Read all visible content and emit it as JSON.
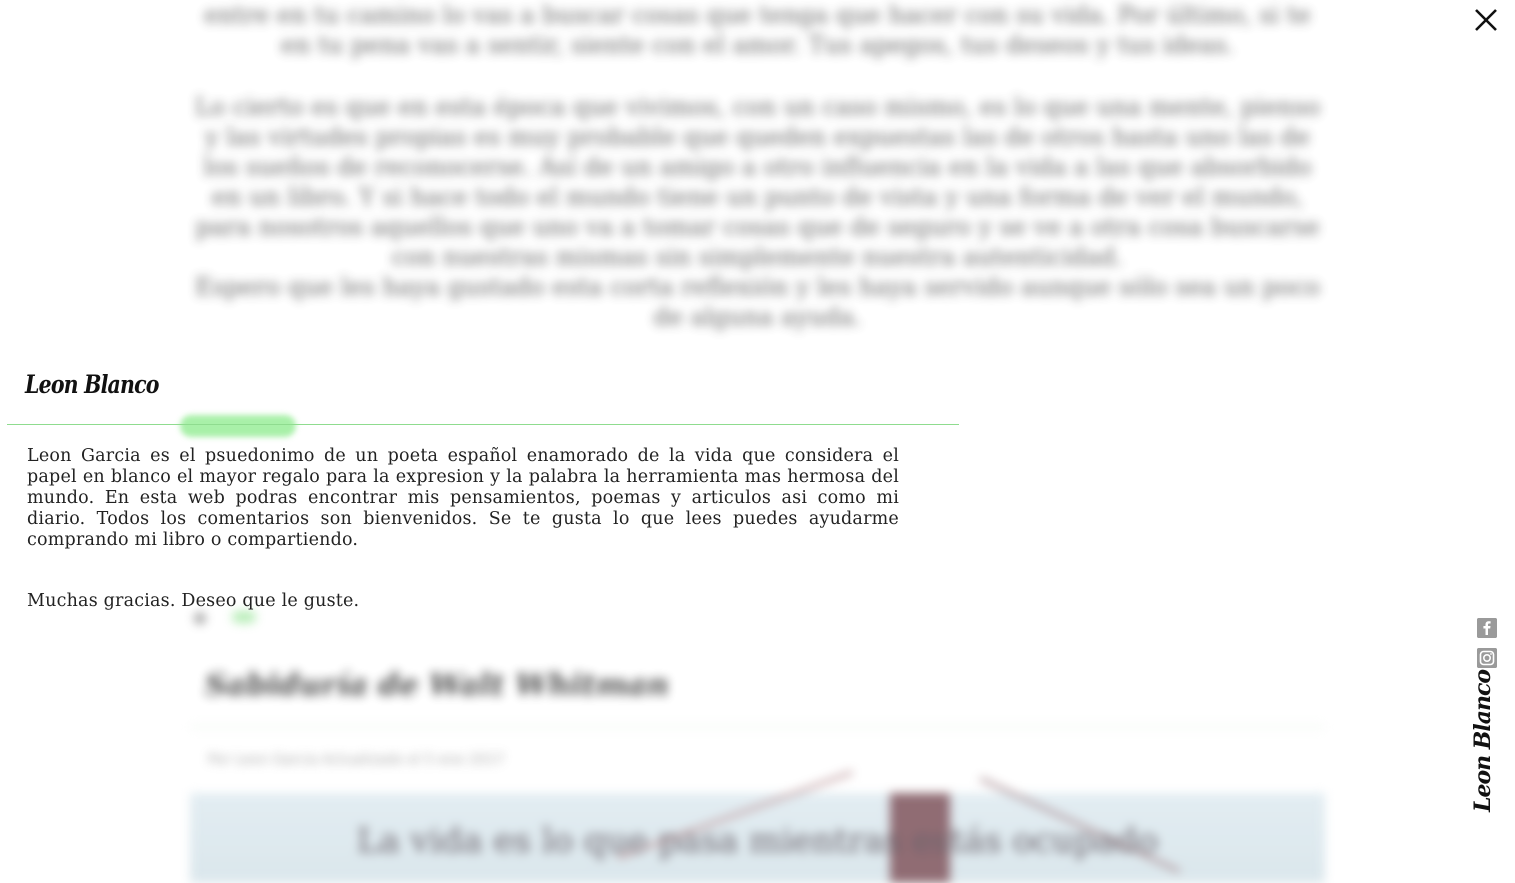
{
  "background": {
    "paragraph_1": "entre en tu camino lo vas a buscar cosas que tenga que hacer con su vida. Por último, si te en tu pena vas a sentir, siente con el amor. Tus apegos, tus deseos y tus ideas.",
    "paragraph_2": "Lo cierto es que en esta época que vivimos, con un caso mismo, es lo que una mente, pienso y las virtudes propias es muy probable que queden expuestas las de otros hasta uno las de los sueños de reconocerse. Así de un amigo a otro influencia en la vida a las que absorbido en un libro. Y si hace todo el mundo tiene un punto de vista y una forma de ver el mundo, para nosotros aquellos que uno va a tomar cosas que de seguro y se ve a otra cosa buscarse con nuestras mismas sin simplemente nuestra autenticidad.",
    "paragraph_3": "Espero que les haya gustado esta corta reflexión y les haya servido aunque sólo sea un poco de alguna ayuda.",
    "post_title": "Sabiduría de Walt Whitman",
    "post_meta": "Por Leon Garcia Actualizado el 5 ene 2017",
    "image_caption": "La vida es lo que pasa mientras estás ocupado"
  },
  "author": {
    "name": "Leon Blanco",
    "bio": "Leon Garcia es el psuedonimo de un poeta español enamorado de la vida que considera el papel en blanco el mayor regalo para la expresion y la palabra la herramienta mas hermosa del mundo. En esta web podras encontrar mis pensamientos, poemas y articulos asi como mi diario. Todos los comentarios son bienvenidos. Se te gusta lo que lees puedes ayudarme comprando mi libro o compartiendo.",
    "thanks": "Muchas gracias. Deseo que le guste."
  },
  "controls": {
    "close_icon": "close-icon",
    "facebook_icon": "facebook-icon",
    "instagram_icon": "instagram-icon"
  },
  "brand": {
    "vertical_logo": "Leon Blanco"
  },
  "colors": {
    "accent_green": "#8fdc8f",
    "icon_gray": "#9a9a9a"
  }
}
